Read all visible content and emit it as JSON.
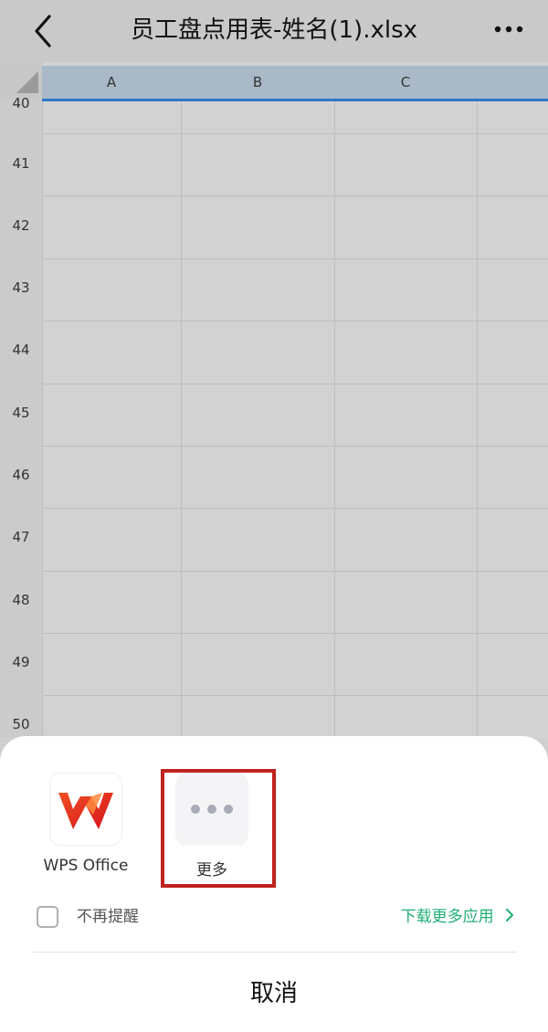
{
  "topbar": {
    "title": "员工盘点用表-姓名(1).xlsx"
  },
  "spreadsheet": {
    "columns": [
      "A",
      "B",
      "C"
    ],
    "rows": [
      "40",
      "41",
      "42",
      "43",
      "44",
      "45",
      "46",
      "47",
      "48",
      "49",
      "50"
    ]
  },
  "open_with_panel": {
    "apps": [
      {
        "label": "WPS Office",
        "icon": "wps-office-icon"
      },
      {
        "label": "更多",
        "icon": "more-dots-icon"
      }
    ],
    "dont_remind_label": "不再提醒",
    "download_more_label": "下载更多应用",
    "cancel_label": "取消"
  },
  "colors": {
    "accent_green": "#1fae73",
    "highlight_red": "#c0221f",
    "selection_blue": "#2f79c7"
  }
}
